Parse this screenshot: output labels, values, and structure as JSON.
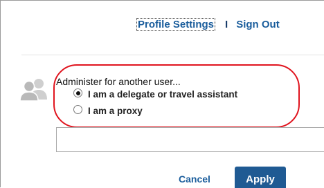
{
  "header": {
    "profile_settings_label": "Profile Settings",
    "separator": "I",
    "sign_out_label": "Sign Out"
  },
  "administer": {
    "title": "Administer for another user...",
    "options": [
      {
        "label": "I am a delegate or travel assistant",
        "selected": true
      },
      {
        "label": "I am a proxy",
        "selected": false
      }
    ],
    "input_value": ""
  },
  "actions": {
    "cancel_label": "Cancel",
    "apply_label": "Apply"
  },
  "icons": {
    "avatar": "users-icon"
  },
  "colors": {
    "link": "#1a5d9c",
    "apply_bg": "#1f5a93",
    "highlight": "#e0141e"
  }
}
